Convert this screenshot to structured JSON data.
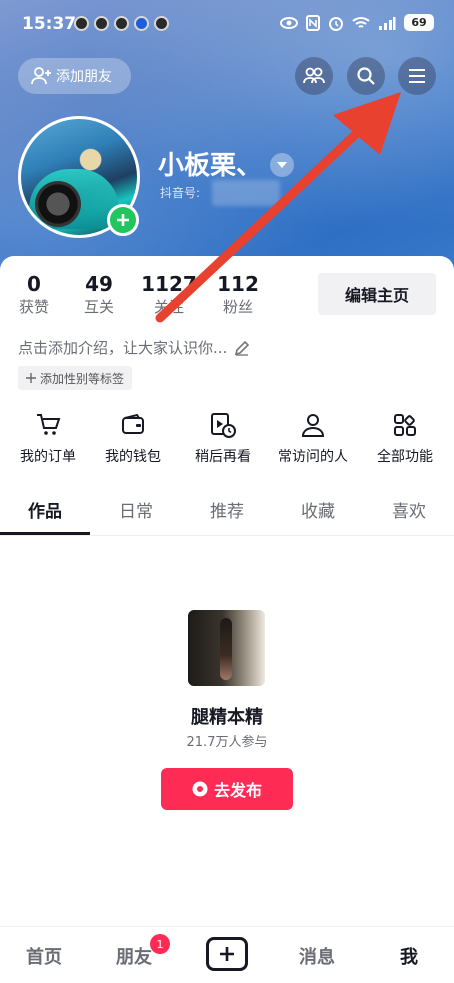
{
  "status_bar": {
    "time": "15:37",
    "battery": "69"
  },
  "header": {
    "add_friend_label": "添加朋友",
    "nickname": "小板栗、",
    "douyin_id_label": "抖音号:"
  },
  "stats": [
    {
      "value": "0",
      "label": "获赞"
    },
    {
      "value": "49",
      "label": "互关"
    },
    {
      "value": "1127",
      "label": "关注"
    },
    {
      "value": "112",
      "label": "粉丝"
    }
  ],
  "edit_profile_label": "编辑主页",
  "bio_placeholder": "点击添加介绍，让大家认识你...",
  "tag_label": "添加性别等标签",
  "features": [
    {
      "icon": "cart-icon",
      "label": "我的订单"
    },
    {
      "icon": "wallet-icon",
      "label": "我的钱包"
    },
    {
      "icon": "watch-later-icon",
      "label": "稍后再看"
    },
    {
      "icon": "person-icon",
      "label": "常访问的人"
    },
    {
      "icon": "grid-icon",
      "label": "全部功能"
    }
  ],
  "tabs": [
    "作品",
    "日常",
    "推荐",
    "收藏",
    "喜欢"
  ],
  "active_tab": "作品",
  "content": {
    "work_title": "腿精本精",
    "work_subtitle": "21.7万人参与",
    "publish_label": "去发布"
  },
  "bottom_nav": {
    "home": "首页",
    "friends": "朋友",
    "friends_badge": "1",
    "messages": "消息",
    "me": "我"
  },
  "colors": {
    "accent": "#fe2c55",
    "add_green": "#22c55e",
    "annotation": "#e8412f"
  }
}
